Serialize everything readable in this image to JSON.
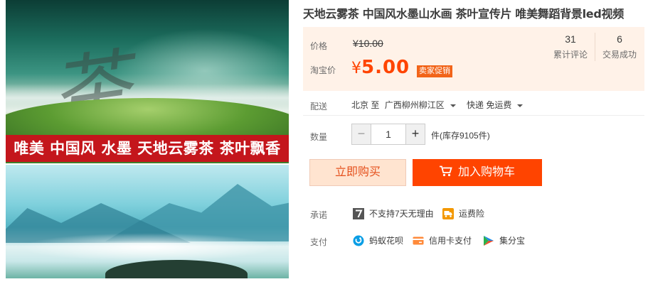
{
  "gallery": {
    "banner_text": "唯美 中国风 水墨 天地云雾茶 茶叶飘香",
    "calligraphy_char": "茶"
  },
  "product": {
    "title": "天地云雾茶 中国风水墨山水画 茶叶宣传片 唯美舞蹈背景led视频"
  },
  "price": {
    "original_label": "价格",
    "original_value": "¥10.00",
    "taobao_label": "淘宝价",
    "currency": "¥",
    "taobao_value": "5.00",
    "promo_badge": "卖家促销",
    "accent_color": "#ff4400"
  },
  "stats": {
    "reviews_count": "31",
    "reviews_label": "累计评论",
    "sold_count": "6",
    "sold_label": "交易成功"
  },
  "shipping": {
    "label": "配送",
    "from": "北京 至",
    "to": "广西柳州柳江区",
    "method": "快递 免运费"
  },
  "quantity": {
    "label": "数量",
    "value": "1",
    "minus": "−",
    "plus": "+",
    "stock_text": "件(库存9105件)"
  },
  "actions": {
    "buy_now": "立即购买",
    "add_to_cart": "加入购物车"
  },
  "promise": {
    "label": "承诺",
    "no_return": "不支持7天无理由",
    "freight_insurance": "运费险"
  },
  "payment": {
    "label": "支付",
    "huabei": "蚂蚁花呗",
    "credit_card": "信用卡支付",
    "jifenbao": "集分宝"
  }
}
